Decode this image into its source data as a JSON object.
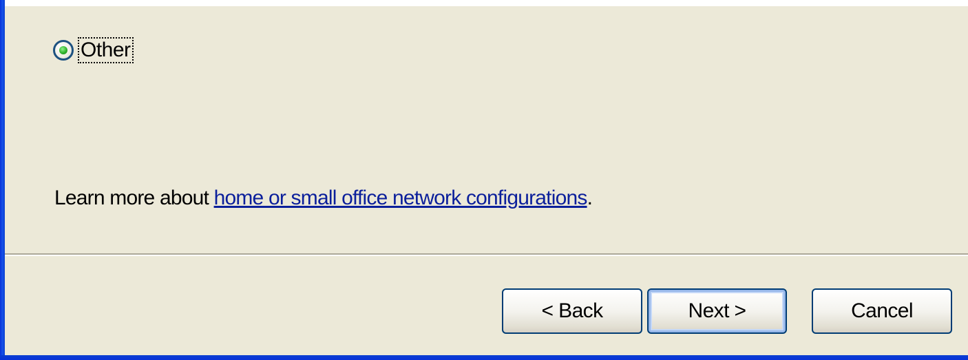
{
  "option": {
    "label": "Other",
    "selected": true
  },
  "learn_more": {
    "prefix": "Learn more about ",
    "link_text": "home or small office network configurations",
    "suffix": "."
  },
  "buttons": {
    "back": "< Back",
    "next": "Next >",
    "cancel": "Cancel"
  },
  "colors": {
    "dialog_background": "#ece9d8",
    "link": "#0b1f9b",
    "frame": "#0831d9",
    "button_border": "#003c74"
  }
}
